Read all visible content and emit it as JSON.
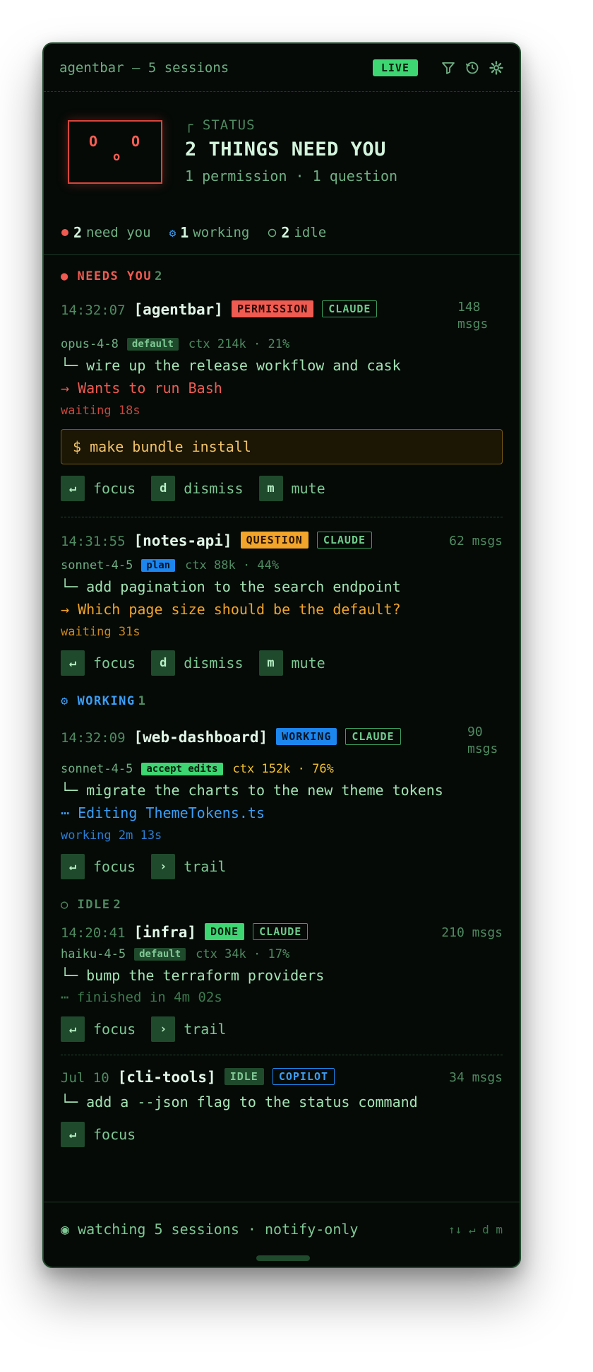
{
  "window": {
    "title": "agentbar — 5 sessions",
    "live": "LIVE"
  },
  "hero": {
    "eye_left": "O",
    "eye_right": "O",
    "mouth": "o",
    "label": "┌ STATUS",
    "title": "2 THINGS NEED YOU",
    "subtitle": "1 permission · 1 question"
  },
  "summary": {
    "need_count": "2",
    "need_label": "need you",
    "working_count": "1",
    "working_label": "working",
    "idle_count": "2",
    "idle_label": "idle"
  },
  "sections": {
    "needs": {
      "title": "NEEDS YOU",
      "count": "2",
      "color": "#ef5b51"
    },
    "working": {
      "title": "WORKING",
      "count": "1",
      "color": "#3b9ef5"
    },
    "idle": {
      "title": "IDLE",
      "count": "2",
      "color": "#4f8a60"
    }
  },
  "sessions": [
    {
      "time": "14:32:07",
      "project": "[agentbar]",
      "state": "PERMISSION",
      "agent": "CLAUDE",
      "msgs": "148 msgs",
      "model": "opus-4-8",
      "mode": "default",
      "ctx": "ctx 214k · 21%",
      "task": "└─ wire up the release workflow and cask",
      "action": "→ Wants to run Bash",
      "waiting": "waiting 18s",
      "command": "$ make bundle install",
      "keys": [
        {
          "key": "↵",
          "label": "focus"
        },
        {
          "key": "d",
          "label": "dismiss"
        },
        {
          "key": "m",
          "label": "mute"
        }
      ]
    },
    {
      "time": "14:31:55",
      "project": "[notes-api]",
      "state": "QUESTION",
      "agent": "CLAUDE",
      "msgs": "62 msgs",
      "model": "sonnet-4-5",
      "mode": "plan",
      "ctx": "ctx 88k · 44%",
      "task": "└─ add pagination to the search endpoint",
      "action": "→ Which page size should be the default?",
      "waiting": "waiting 31s",
      "keys": [
        {
          "key": "↵",
          "label": "focus"
        },
        {
          "key": "d",
          "label": "dismiss"
        },
        {
          "key": "m",
          "label": "mute"
        }
      ]
    },
    {
      "time": "14:32:09",
      "project": "[web-dashboard]",
      "state": "WORKING",
      "agent": "CLAUDE",
      "msgs": "90 msgs",
      "model": "sonnet-4-5",
      "mode": "accept edits",
      "ctx": "ctx 152k · 76%",
      "task": "└─ migrate the charts to the new theme tokens",
      "action": "⋯ Editing ThemeTokens.ts",
      "waiting": "working 2m 13s",
      "keys": [
        {
          "key": "↵",
          "label": "focus"
        },
        {
          "key": "›",
          "label": "trail"
        }
      ]
    },
    {
      "time": "14:20:41",
      "project": "[infra]",
      "state": "DONE",
      "agent": "CLAUDE",
      "msgs": "210 msgs",
      "model": "haiku-4-5",
      "mode": "default",
      "ctx": "ctx 34k · 17%",
      "task": "└─ bump the terraform providers",
      "action": "⋯ finished in 4m 02s",
      "keys": [
        {
          "key": "↵",
          "label": "focus"
        },
        {
          "key": "›",
          "label": "trail"
        }
      ]
    },
    {
      "time": "Jul 10",
      "project": "[cli-tools]",
      "state": "IDLE",
      "agent": "COPILOT",
      "msgs": "34 msgs",
      "task": "└─ add a --json flag to the status command",
      "keys": [
        {
          "key": "↵",
          "label": "focus"
        }
      ]
    }
  ],
  "footer": {
    "watching": "◉ watching 5 sessions · notify-only",
    "hint": "↑↓ ↵ d m"
  }
}
